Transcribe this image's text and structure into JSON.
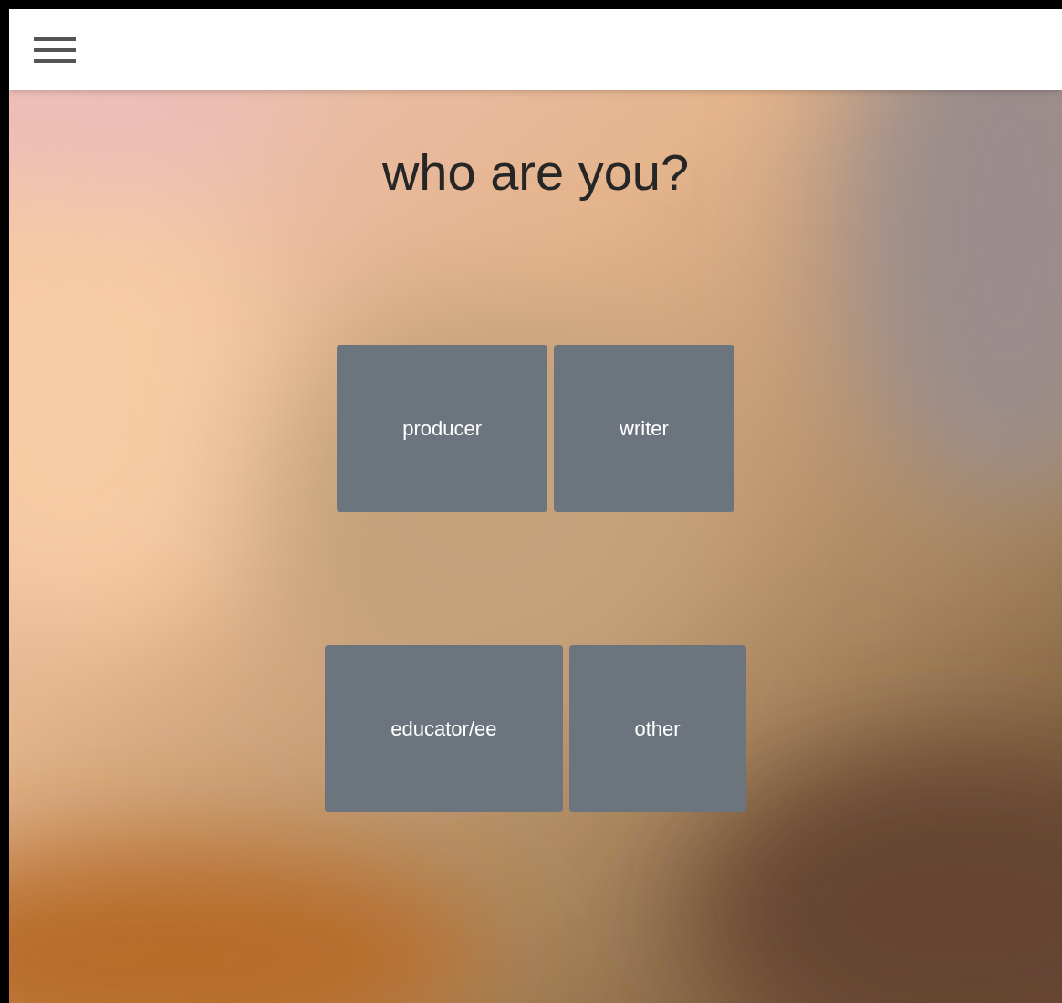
{
  "title": "who are you?",
  "options": [
    {
      "label": "producer"
    },
    {
      "label": "writer"
    },
    {
      "label": "educator/ee"
    },
    {
      "label": "other"
    }
  ]
}
